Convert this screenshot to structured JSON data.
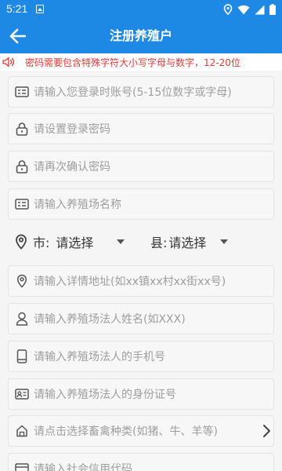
{
  "status_bar": {
    "time": "5:21",
    "icons": [
      "notification-icon",
      "location-icon",
      "wifi-icon",
      "signal-icon",
      "battery-icon"
    ]
  },
  "app_bar": {
    "title": "注册养殖户",
    "back_icon": "back-arrow-icon"
  },
  "notice": {
    "text": "密码需要包含特殊字符大小写字母与数字，12-20位",
    "icon": "speaker-icon",
    "color": "#e53935"
  },
  "form": {
    "account_placeholder": "请输入您登录时账号(5-15位数字或字母)",
    "password_placeholder": "请设置登录密码",
    "confirm_password_placeholder": "请再次确认密码",
    "farm_name_placeholder": "请输入养殖场名称",
    "region": {
      "city_label": "市:",
      "city_value": "请选择",
      "county_label": "县:",
      "county_value": "请选择"
    },
    "address_placeholder": "请输入详情地址(如xx镇xx村xx街xx号)",
    "legal_name_placeholder": "请输入养殖场法人姓名(如XXX)",
    "legal_phone_placeholder": "请输入养殖场法人的手机号",
    "legal_id_placeholder": "请输入养殖场法人的身份证号",
    "livestock_placeholder": "请点击选择畜禽种类(如猪、牛、羊等)",
    "credit_code_placeholder": "请输入社会信用代码"
  },
  "colors": {
    "primary": "#1e88e5",
    "notice": "#e53935",
    "placeholder": "#9e9e9e"
  }
}
